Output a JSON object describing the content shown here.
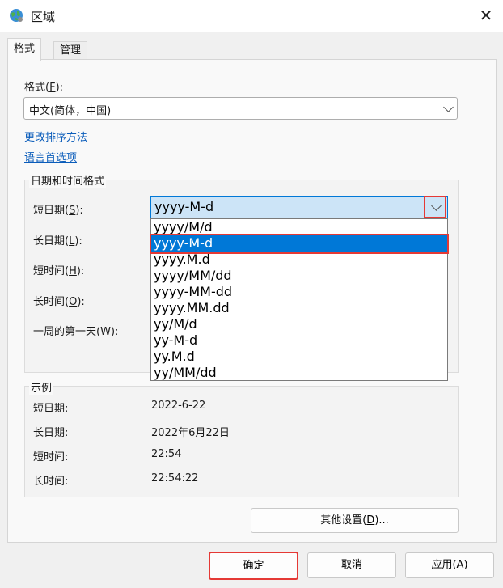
{
  "window": {
    "title": "区域",
    "close_glyph": "✕"
  },
  "tabs": [
    {
      "label": "格式"
    },
    {
      "label": "管理"
    }
  ],
  "format": {
    "label_prefix": "格式(",
    "label_key": "F",
    "label_suffix": "):",
    "selected": "中文(简体，中国)"
  },
  "links": {
    "change_sort": "更改排序方法",
    "language_prefs": "语言首选项"
  },
  "datetime": {
    "group_title": "日期和时间格式",
    "short_date": {
      "prefix": "短日期(",
      "key": "S",
      "suffix": "):"
    },
    "long_date": {
      "prefix": "长日期(",
      "key": "L",
      "suffix": "):"
    },
    "short_time": {
      "prefix": "短时间(",
      "key": "H",
      "suffix": "):"
    },
    "long_time": {
      "prefix": "长时间(",
      "key": "O",
      "suffix": "):"
    },
    "first_day": {
      "prefix": "一周的第一天(",
      "key": "W",
      "suffix": "):"
    },
    "short_date_value": "yyyy-M-d",
    "dropdown_options": [
      "yyyy/M/d",
      "yyyy-M-d",
      "yyyy.M.d",
      "yyyy/MM/dd",
      "yyyy-MM-dd",
      "yyyy.MM.dd",
      "yy/M/d",
      "yy-M-d",
      "yy.M.d",
      "yy/MM/dd"
    ],
    "selected_index": 1
  },
  "examples": {
    "group_title": "示例",
    "rows": [
      {
        "label": "短日期:",
        "value": "2022-6-22"
      },
      {
        "label": "长日期:",
        "value": "2022年6月22日"
      },
      {
        "label": "短时间:",
        "value": "22:54"
      },
      {
        "label": "长时间:",
        "value": "22:54:22"
      }
    ]
  },
  "buttons": {
    "other_settings": {
      "prefix": "其他设置(",
      "key": "D",
      "suffix": ")..."
    },
    "ok": "确定",
    "cancel": "取消",
    "apply": {
      "prefix": "应用(",
      "key": "A",
      "suffix": ")"
    }
  },
  "colors": {
    "accent": "#0078d7",
    "highlight_outline": "#e53935",
    "link": "#0a5cba"
  }
}
